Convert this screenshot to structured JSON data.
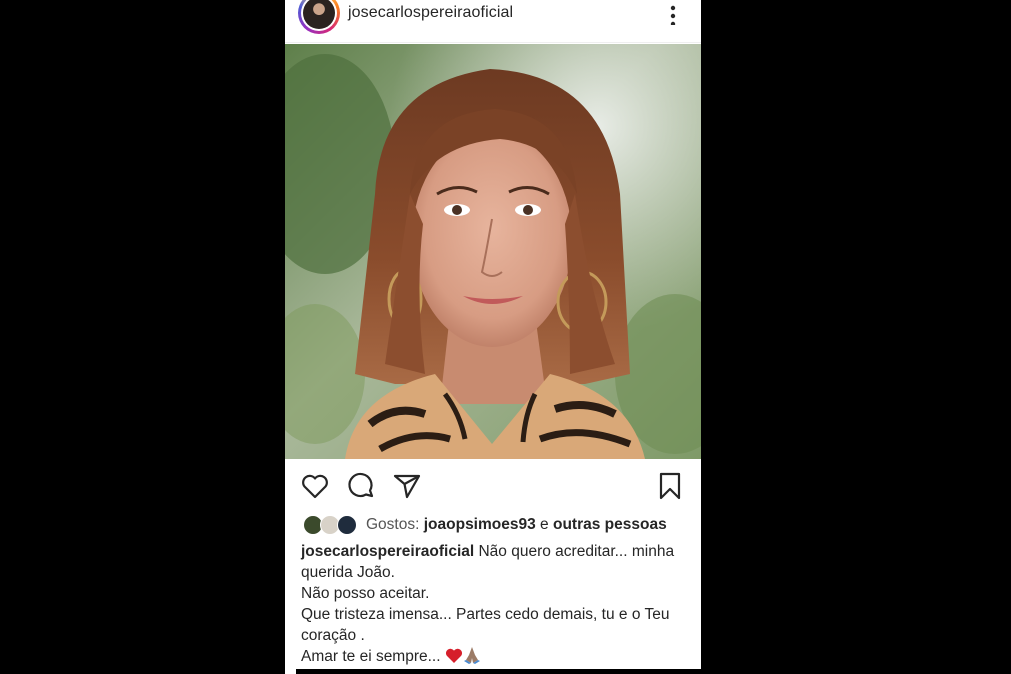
{
  "post": {
    "username": "josecarlospereiraoficial",
    "likes": {
      "prefix": "Gostos:",
      "first_liker": "joaopsimoes93",
      "connector": "e",
      "others": "outras pessoas"
    },
    "caption": {
      "username": "josecarlospereiraoficial",
      "lines": [
        "Não quero acreditar... minha",
        "querida João.",
        "Não posso aceitar.",
        "Que tristeza imensa... Partes cedo demais, tu e o Teu",
        "coração .",
        "Amar te ei sempre..."
      ]
    }
  },
  "icons": {
    "more": "more-vertical-icon",
    "like": "heart-icon",
    "comment": "comment-icon",
    "share": "send-icon",
    "save": "bookmark-icon"
  },
  "colors": {
    "background": "#000000",
    "card": "#ffffff",
    "text": "#262626",
    "heart_emoji": "#d61f2b"
  }
}
